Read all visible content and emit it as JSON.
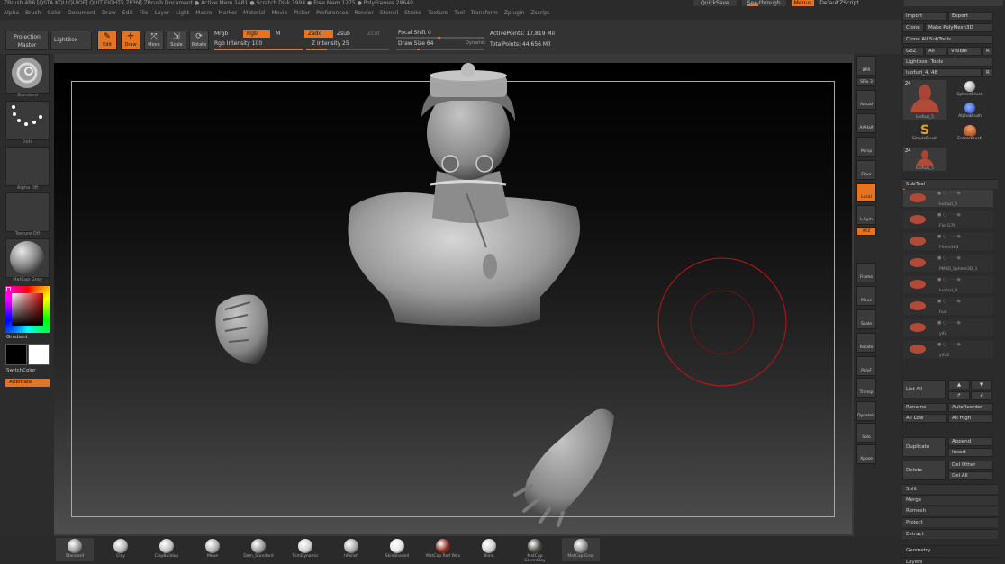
{
  "window": {
    "title": "ZBrush 4R6 [QSTA KQU QUIOF] QUIT FIGHTS 7P3N]     ZBrush Document     ● Active Mem 1481  ● Scratch Disk 3994  ● Free Mem 1275  ● PolyFrames 28640",
    "menus": [
      "Alpha",
      "Brush",
      "Color",
      "Document",
      "Draw",
      "Edit",
      "File",
      "Layer",
      "Light",
      "Macro",
      "Marker",
      "Material",
      "Movie",
      "Picker",
      "Preferences",
      "Render",
      "Stencil",
      "Stroke",
      "Texture",
      "Tool",
      "Transform",
      "Zplugin",
      "Zscript"
    ],
    "quicksave": "QuickSave",
    "see_through": "See-through",
    "see_through_value": 0,
    "menus_toggle": "Menus",
    "default_script": "DefaultZScript"
  },
  "toolbar": {
    "projection_master": "Projection Master",
    "lightbox": "LightBox",
    "edit": "Edit",
    "draw": "Draw",
    "move": "Move",
    "scale": "Scale",
    "rotate": "Rotate",
    "mrgb": "Mrgb",
    "rgb": "Rgb",
    "m": "M",
    "rgb_intensity": "Rgb Intensity 100",
    "rgb_intensity_value": 100,
    "zadd": "Zadd",
    "zsub": "Zsub",
    "zcut": "Zcut",
    "z_intensity": "Z Intensity 25",
    "z_intensity_value": 25,
    "focal_shift": "Focal Shift 0",
    "draw_size": "Draw Size 64",
    "dynamic": "Dynamic",
    "active_points": "ActivePoints: 17,819  Mil",
    "total_points": "TotalPoints: 44,656  Mil"
  },
  "left_shelf": {
    "brush_label": "Standard",
    "stroke_label": "Dots",
    "alpha_label": "Alpha Off",
    "texture_label": "Texture Off",
    "material_label": "MatCap Gray",
    "gradient_label": "Gradient",
    "switch_color": "SwitchColor",
    "alternate": "Alternate"
  },
  "right_shelf": [
    {
      "label": "BPR",
      "on": false
    },
    {
      "label": "SPix 3",
      "on": false
    },
    {
      "label": "Actual",
      "on": false
    },
    {
      "label": "AAHalf",
      "on": false
    },
    {
      "label": "Persp",
      "on": false
    },
    {
      "label": "Floor",
      "on": false
    },
    {
      "label": "Local",
      "on": true
    },
    {
      "label": "L.Sym",
      "on": false
    },
    {
      "label": "XYZ",
      "on": true
    },
    {
      "label": "Frame",
      "on": false
    },
    {
      "label": "Move",
      "on": false
    },
    {
      "label": "Scale",
      "on": false
    },
    {
      "label": "Rotate",
      "on": false
    },
    {
      "label": "PolyF",
      "on": false
    },
    {
      "label": "Transp",
      "on": false
    },
    {
      "label": "Dynamic",
      "on": false
    },
    {
      "label": "Solo",
      "on": false
    },
    {
      "label": "Xpose",
      "on": false
    }
  ],
  "tool_panel": {
    "import": "Import",
    "export": "Export",
    "clone": "Clone",
    "make_polymesh": "Make PolyMesh3D",
    "clone_all_subtools": "Clone All SubTools",
    "goz": "GoZ",
    "all": "All",
    "visible": "Visible",
    "r": "R",
    "lightbox_tools": "Lightbox› Tools",
    "current_tool": "luofuzi_4. 48",
    "tools": [
      {
        "name": "luofuzi_5",
        "count": "24"
      },
      {
        "name": "SphereBrush"
      },
      {
        "name": "AlphaBrush"
      },
      {
        "name": "SimpleBrush"
      },
      {
        "name": "EraserBrush"
      },
      {
        "name": "luofuzi_5",
        "count": "24"
      }
    ],
    "subtool_header": "SubTool",
    "subtools": [
      "luofuzi_5",
      "Fleri176",
      "Fhere163",
      "PM3D_Sphere3D_1",
      "luofuzi_8",
      "hua",
      "yifu",
      "yifu2"
    ],
    "list_all": "List All",
    "rename": "Rename",
    "auto_reorder": "AutoReorder",
    "all_low": "All Low",
    "all_high": "All High",
    "duplicate": "Duplicate",
    "append": "Append",
    "insert": "Insert",
    "delete": "Delete",
    "del_other": "Del Other",
    "del_all": "Del All",
    "split": "Split",
    "merge": "Merge",
    "remesh": "Remesh",
    "project": "Project",
    "extract": "Extract",
    "geometry": "Geometry",
    "layers": "Layers"
  },
  "materials": [
    {
      "label": "Standard",
      "color": "#9a9a9a"
    },
    {
      "label": "Clay",
      "color": "#b5b5b5"
    },
    {
      "label": "ClayBuildup",
      "color": "#c2c2c2"
    },
    {
      "label": "Move",
      "color": "#b0b0b0"
    },
    {
      "label": "Dam_Standard",
      "color": "#9c9c9c"
    },
    {
      "label": "TrimDynamic",
      "color": "#d0d0d0"
    },
    {
      "label": "hPolish",
      "color": "#a9a9a9"
    },
    {
      "label": "SkinShade4",
      "color": "#e5e5e5"
    },
    {
      "label": "MatCap Red Wax",
      "color": "#8a2a1a"
    },
    {
      "label": "Blinn",
      "color": "#cfcfcf"
    },
    {
      "label": "MatCap GreenClay",
      "color": "#4a4a40"
    },
    {
      "label": "MatCap Gray",
      "color": "#8d8d8d"
    }
  ],
  "colors": {
    "accent": "#e6731f",
    "brush_cursor": "#c01818"
  }
}
